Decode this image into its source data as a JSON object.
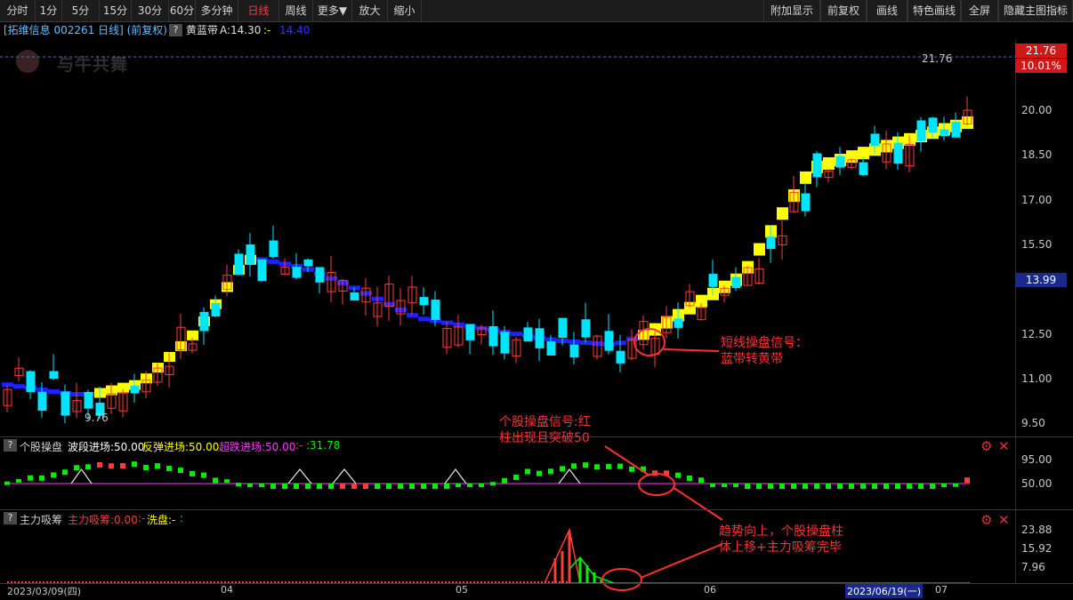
{
  "toolbar": {
    "left": [
      "分时",
      "1分",
      "5分",
      "15分",
      "30分",
      "60分",
      "多分钟",
      "日线",
      "周线",
      "更多▼",
      "放大",
      "缩小"
    ],
    "active": "日线",
    "right": [
      "附加显示",
      "前复权",
      "画线",
      "特色画线",
      "全屏",
      "隐藏主图指标"
    ]
  },
  "main_header": {
    "title": "[拓维信息 002261 日线] (前复权)",
    "help": "?",
    "indicator": "黄蓝带",
    "value_a": "A:14.30",
    "value_b": ":-",
    "value_c": "14.40"
  },
  "watermark": "与牛共舞",
  "price_axis": [
    "20.00",
    "18.50",
    "17.00",
    "15.50",
    "14.00",
    "12.50",
    "11.00",
    "9.50"
  ],
  "price_boxes": {
    "top": "21.76",
    "top_pct": "10.01%",
    "current": "13.99"
  },
  "extremes": {
    "high": "21.76",
    "low": "9.76"
  },
  "panel2": {
    "help": "?",
    "name": "个股操盘",
    "l1": "波段进场:50.00",
    "l2": "反弹进场:50.00",
    "l3": "超跌进场:50.00",
    "l4": ":-",
    "l5": ":31.78",
    "axis": [
      "95.00",
      "50.00"
    ]
  },
  "panel3": {
    "help": "?",
    "name": "主力吸筹",
    "l1": "主力吸筹:0.00",
    "l2": ":-",
    "l3": "洗盘:-",
    "l4": ":",
    "axis": [
      "23.88",
      "15.92",
      "7.96"
    ]
  },
  "dates": {
    "start": "2023/03/09(四)",
    "m04": "04",
    "m05": "05",
    "m06": "06",
    "cursor": "2023/06/19(一)",
    "m07": "07"
  },
  "annotations": {
    "a1_line1": "短线操盘信号：",
    "a1_line2": "蓝带转黄带",
    "a2_line1": "个股操盘信号:红",
    "a2_line2": "柱出现且突破50",
    "a3_line1": "趋势向上，个股操盘柱",
    "a3_line2": "体上移+主力吸筹完毕"
  },
  "colors": {
    "up": "#ff3b3b",
    "down": "#00e5ff",
    "yellow": "#ffff00",
    "blue": "#1e22ff",
    "magenta": "#ff33ff",
    "green": "#00ee00",
    "anno": "#ff3030",
    "box_red": "#d01818",
    "box_blue": "#1a2a8c"
  },
  "icons": {
    "gear": "gear-icon",
    "close": "close-icon"
  }
}
